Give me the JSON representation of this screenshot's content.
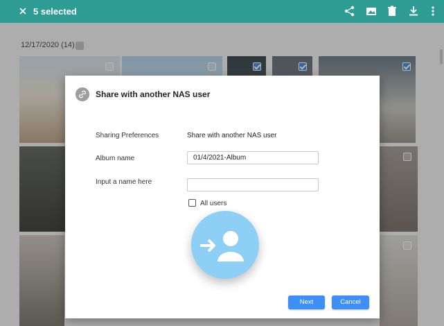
{
  "topbar": {
    "title": "5 selected",
    "icons": [
      "close-icon",
      "share-icon",
      "add-to-album-icon",
      "delete-icon",
      "download-icon",
      "more-vert-icon"
    ],
    "color": "#2f9c94"
  },
  "gallery": {
    "date_label": "12/17/2020 (14)"
  },
  "dialog": {
    "title": "Share with another NAS user",
    "sharing_preferences_label": "Sharing Preferences",
    "sharing_preferences_value": "Share with another NAS user",
    "album_name_label": "Album name",
    "album_name_value": "01/4/2021-Album",
    "input_name_label": "Input a name here",
    "input_name_value": "",
    "all_users_label": "All users",
    "all_users_checked": false,
    "next_label": "Next",
    "cancel_label": "Cancel",
    "accent_color": "#3d8ff5"
  },
  "overlay_icon": "add-user-icon"
}
